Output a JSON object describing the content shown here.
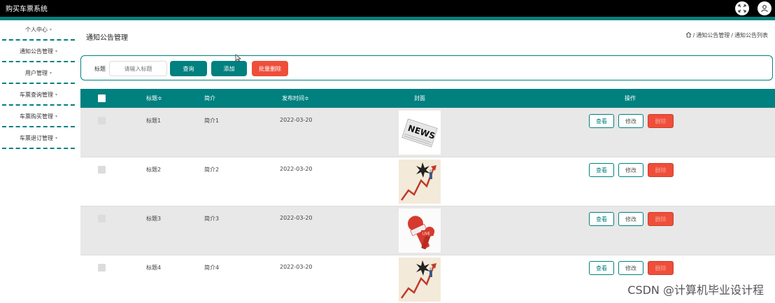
{
  "app": {
    "title": "购买车票系统"
  },
  "sidebar": {
    "items": [
      {
        "label": "个人中心"
      },
      {
        "label": "通知公告管理"
      },
      {
        "label": "用户管理"
      },
      {
        "label": "车票查询管理"
      },
      {
        "label": "车票购买管理"
      },
      {
        "label": "车票退订管理"
      }
    ]
  },
  "page": {
    "title": "通知公告管理",
    "breadcrumb": [
      "通知公告管理",
      "通知公告列表"
    ],
    "breadcrumb_sep": "/"
  },
  "search": {
    "label": "标题",
    "placeholder": "请输入标题",
    "query_label": "查询",
    "add_label": "添加",
    "batch_delete_label": "批量删除"
  },
  "table": {
    "columns": [
      "标题≑",
      "简介",
      "发布时间≑",
      "封面",
      "操作"
    ],
    "rows": [
      {
        "title": "标题1",
        "intro": "简介1",
        "date": "2022-03-20",
        "cover": "news-newspaper-image"
      },
      {
        "title": "标题2",
        "intro": "简介2",
        "date": "2022-03-20",
        "cover": "rising-arrow-chart-image"
      },
      {
        "title": "标题3",
        "intro": "简介3",
        "date": "2022-03-20",
        "cover": "live-microphone-image"
      },
      {
        "title": "标题4",
        "intro": "简介4",
        "date": "2022-03-20",
        "cover": "rising-arrow-chart-image"
      }
    ],
    "actions": {
      "view": "查看",
      "edit": "修改",
      "delete": "删除"
    }
  },
  "watermark": "CSDN @计算机毕业设计程",
  "colors": {
    "accent": "#00807f",
    "danger": "#ef4e3a",
    "topbar": "#000000"
  }
}
